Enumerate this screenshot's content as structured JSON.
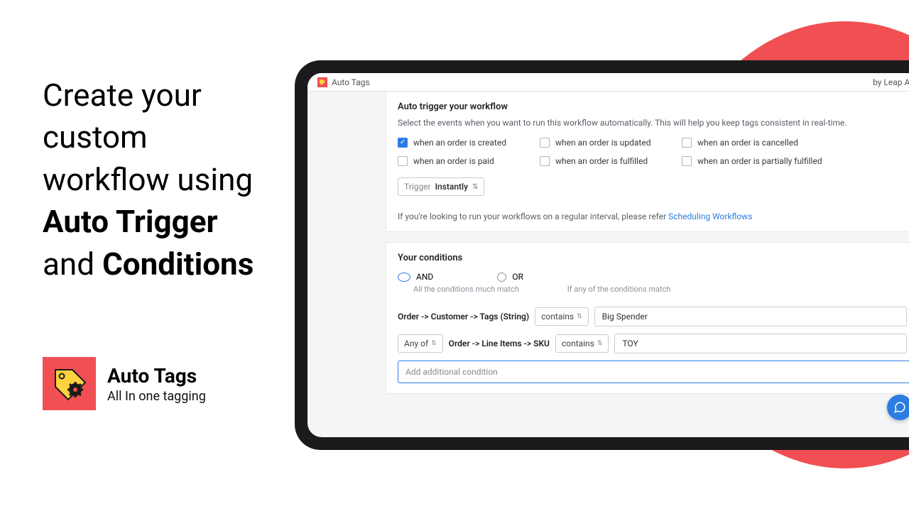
{
  "hero": {
    "line1": "Create your custom workflow using ",
    "strong1": "Auto Trigger",
    "mid": " and ",
    "strong2": "Conditions"
  },
  "brand": {
    "title": "Auto Tags",
    "subtitle": "All In one tagging"
  },
  "topbar": {
    "app": "Auto Tags",
    "byline": "by Leap Apps"
  },
  "trigger": {
    "heading": "Auto trigger your workflow",
    "sub": "Select the events when you want to run this workflow automatically. This will help you keep tags consistent in real-time.",
    "events": [
      {
        "label": "when an order is created",
        "checked": true
      },
      {
        "label": "when an order is updated",
        "checked": false
      },
      {
        "label": "when an order is cancelled",
        "checked": false
      },
      {
        "label": "when an order is paid",
        "checked": false
      },
      {
        "label": "when an order is fulfilled",
        "checked": false
      },
      {
        "label": "when an order is partially fulfilled",
        "checked": false
      }
    ],
    "timing_prefix": "Trigger",
    "timing_value": "Instantly",
    "note_prefix": "If you're looking to run your workflows on a regular interval, please refer ",
    "note_link": "Scheduling Workflows"
  },
  "conditions": {
    "heading": "Your conditions",
    "logic": {
      "and": {
        "label": "AND",
        "hint": "All the conditions much match",
        "selected": true
      },
      "or": {
        "label": "OR",
        "hint": "If any of the conditions match",
        "selected": false
      }
    },
    "rows": [
      {
        "scope": null,
        "path": "Order -> Customer -> Tags (String)",
        "op": "contains",
        "value": "Big Spender"
      },
      {
        "scope": "Any of",
        "path": "Order -> Line Items -> SKU",
        "op": "contains",
        "value": "TOY"
      }
    ],
    "add_placeholder": "Add additional condition"
  }
}
